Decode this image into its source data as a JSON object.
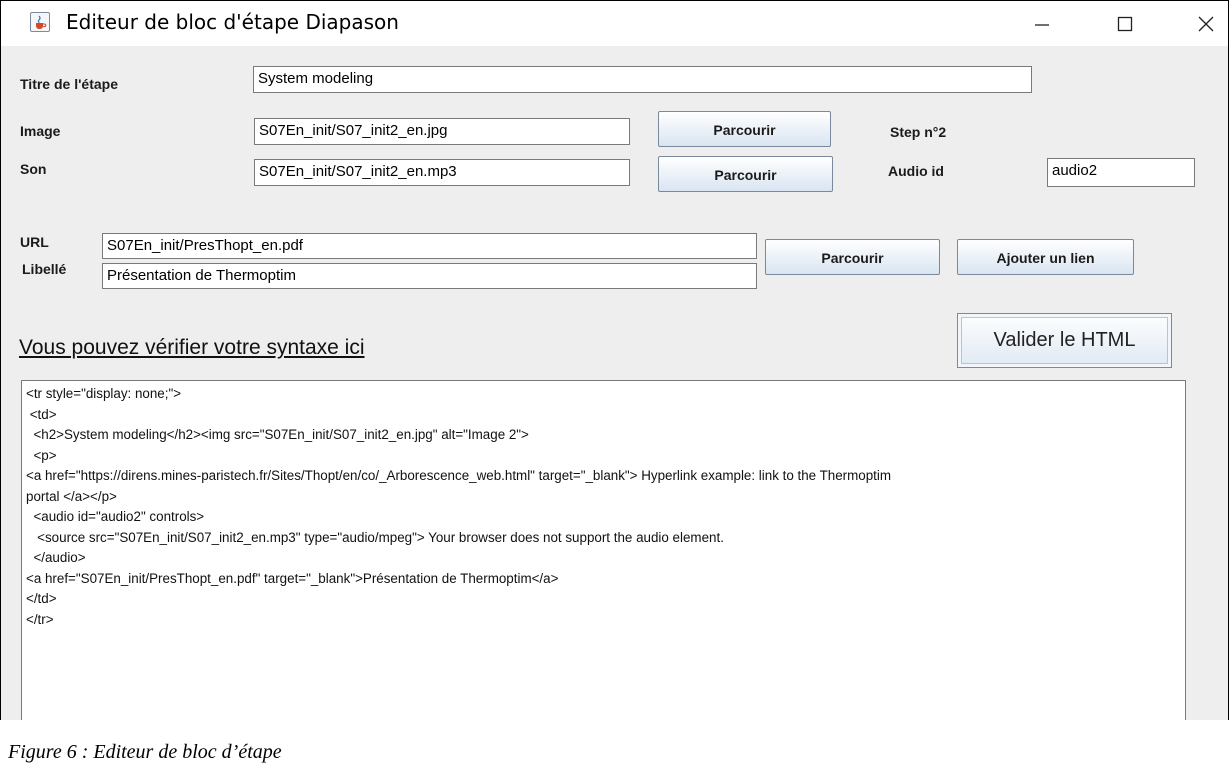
{
  "window": {
    "title": "Editeur de bloc d'étape Diapason",
    "app_icon": "java-cup-icon",
    "controls": [
      "minimize-icon",
      "maximize-icon",
      "close-icon"
    ]
  },
  "form": {
    "step_title_label": "Titre de l'étape",
    "step_title_value": "System modeling",
    "image_label": "Image",
    "image_value": "S07En_init/S07_init2_en.jpg",
    "image_browse_label": "Parcourir",
    "step_number_text": "Step n°2",
    "sound_label": "Son",
    "sound_value": "S07En_init/S07_init2_en.mp3",
    "sound_browse_label": "Parcourir",
    "audio_id_label": "Audio id",
    "audio_id_value": "audio2",
    "url_label": "URL",
    "url_value": "S07En_init/PresThopt_en.pdf",
    "link_label_label": "Libellé",
    "link_label_value": "Présentation de Thermoptim",
    "url_browse_label": "Parcourir",
    "add_link_label": "Ajouter un lien"
  },
  "html_check": {
    "heading": "Vous pouvez vérifier votre syntaxe ici",
    "validate_label": "Valider le HTML",
    "code_lines": [
      "<tr style=\"display: none;\">",
      " <td>",
      "  <h2>System modeling</h2><img src=\"S07En_init/S07_init2_en.jpg\" alt=\"Image 2\">",
      "  <p>",
      "<a href=\"https://direns.mines-paristech.fr/Sites/Thopt/en/co/_Arborescence_web.html\" target=\"_blank\"> Hyperlink example: link to the Thermoptim",
      "portal </a></p>",
      "  <audio id=\"audio2\" controls>",
      "   <source src=\"S07En_init/S07_init2_en.mp3\" type=\"audio/mpeg\"> Your browser does not support the audio element.",
      "  </audio>",
      "<a href=\"S07En_init/PresThopt_en.pdf\" target=\"_blank\">Présentation de Thermoptim</a>",
      "</td>",
      "</tr>"
    ]
  },
  "caption": "Figure 6 : Editeur de bloc d’étape"
}
